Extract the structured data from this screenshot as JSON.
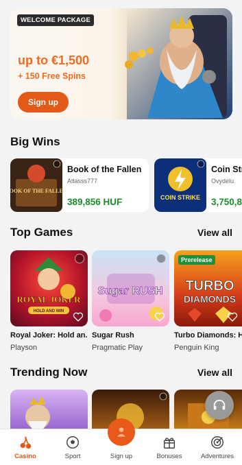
{
  "hero": {
    "badge": "WELCOME PACKAGE",
    "amount": "up to €1,500",
    "spins": "+ 150 Free Spins",
    "cta": "Sign up"
  },
  "big_wins": {
    "title": "Big Wins",
    "items": [
      {
        "game": "Book of the Fallen",
        "user": "Atlasss777",
        "amount": "389,856 HUF"
      },
      {
        "game": "Coin Str",
        "user": "Ovydelu",
        "amount": "3,750,8"
      }
    ]
  },
  "top_games": {
    "title": "Top Games",
    "view_all": "View all",
    "items": [
      {
        "title": "Royal Joker: Hold an...",
        "provider": "Playson"
      },
      {
        "title": "Sugar Rush",
        "provider": "Pragmatic Play"
      },
      {
        "title": "Turbo Diamonds: Ho",
        "provider": "Penguin King",
        "badge": "Prerelease"
      }
    ]
  },
  "trending": {
    "title": "Trending Now",
    "view_all": "View all"
  },
  "art_text": {
    "book_fallen": "BOOK OF THE FALLEN",
    "coin_strike": "COIN STRIKE",
    "royal_joker": "ROYAL JOKER",
    "hold_and_win": "HOLD AND WIN",
    "sugar_rush": "Sugar RUSH",
    "turbo": "TURBO",
    "diamonds": "DIAMONDS"
  },
  "bottom_nav": {
    "items": [
      {
        "label": "Casino",
        "icon": "cherries-icon",
        "active": true
      },
      {
        "label": "Sport",
        "icon": "soccer-ball-icon"
      },
      {
        "label": "Sign up",
        "icon": "user-icon"
      },
      {
        "label": "Bonuses",
        "icon": "gift-icon"
      },
      {
        "label": "Adventures",
        "icon": "target-icon"
      }
    ]
  },
  "colors": {
    "accent": "#e35a18",
    "win_green": "#1a8f2c",
    "background": "#f2f3f5"
  }
}
